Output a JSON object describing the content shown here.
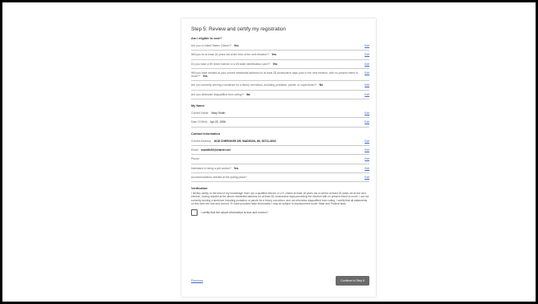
{
  "page": {
    "title": "Step 5: Review and certify my registration",
    "eligibility": {
      "heading": "Am I eligible to vote?",
      "rows": [
        {
          "q": "Are you a United States Citizen?*",
          "a": "Yes",
          "edit": "Edit"
        },
        {
          "q": "Will you be at least 18 years old at the time of the next election?*",
          "a": "Yes",
          "edit": "Edit"
        },
        {
          "q": "Do you have a WI driver license or a WI state identification card?*",
          "a": "Yes",
          "edit": "Edit"
        },
        {
          "q": "Will you have resided at your current residential address for at least 28 consecutive days prior to the next election, with no present intent to move?*",
          "a": "Yes",
          "edit": "Edit"
        },
        {
          "q": "Are you currently serving a sentence for a felony conviction, including probation, parole, or supervision?*",
          "a": "No",
          "edit": "Edit"
        },
        {
          "q": "Are you otherwise disqualified from voting?*",
          "a": "No",
          "edit": "Edit"
        }
      ]
    },
    "name": {
      "heading": "My Name",
      "rows": [
        {
          "q": "Current Name:",
          "a": "Mary Smith",
          "edit": "Edit"
        },
        {
          "q": "Date Of Birth:",
          "a": "Apr 23, 1956",
          "edit": "Edit"
        }
      ]
    },
    "contact": {
      "heading": "Contact Information",
      "rows": [
        {
          "q": "Current Address:",
          "a": "4016 CHEROKEE DR, MADISON, WI, 53711-3002",
          "edit": "Edit"
        },
        {
          "q": "Email:",
          "a": "msmith02@charter.net",
          "edit": "Edit"
        },
        {
          "q": "Phone:",
          "a": "",
          "edit": "Edit"
        },
        {
          "q": "Interested in being a poll worker?",
          "a": "Yes",
          "edit": "Edit"
        },
        {
          "q": "Accommodations needed at the polling place?",
          "a": "",
          "edit": "Edit"
        }
      ]
    },
    "verification": {
      "heading": "Verification",
      "text": "I hereby certify, to the best of my knowledge, that I am a qualified elector, a U.S. citizen at least 18 years old or will be at least 18 years old at the next election, having resided at the above residential address for at least 28 consecutive days preceding the election with no present intent to move. I am not currently serving a sentence including probation or parole for a felony conviction, and not otherwise disqualified from voting. I certify that all statements on this form are true and correct. If I have provided false information I may be subject to imprisonment under State and Federal laws.",
      "checkbox_label": "I certify that the above information is true and correct.*"
    },
    "footer": {
      "previous": "Previous",
      "continue": "Continue to Step 6"
    }
  }
}
